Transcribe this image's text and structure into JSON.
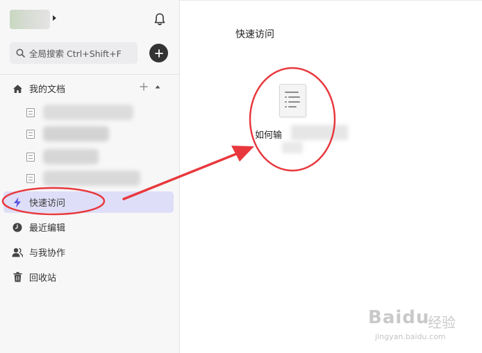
{
  "header": {
    "search_placeholder": "全局搜索 Ctrl+Shift+F"
  },
  "sidebar": {
    "my_docs": {
      "label": "我的文档",
      "icon": "home-icon"
    },
    "docs": [
      {
        "icon": "document-icon"
      },
      {
        "icon": "document-icon"
      },
      {
        "icon": "document-icon"
      },
      {
        "icon": "document-icon"
      }
    ],
    "items": [
      {
        "label": "快速访问",
        "icon": "lightning-icon",
        "active": true
      },
      {
        "label": "最近编辑",
        "icon": "clock-icon"
      },
      {
        "label": "与我协作",
        "icon": "users-icon"
      },
      {
        "label": "回收站",
        "icon": "trash-icon"
      }
    ]
  },
  "main": {
    "title": "快速访问",
    "file": {
      "name": "如何输"
    }
  },
  "watermark": {
    "logo": "Baidu",
    "cn": "经验",
    "url": "jingyan.baidu.com"
  },
  "colors": {
    "accent": "#5a52e0",
    "active_bg": "#dfdef8",
    "annotation": "#e8383d"
  }
}
